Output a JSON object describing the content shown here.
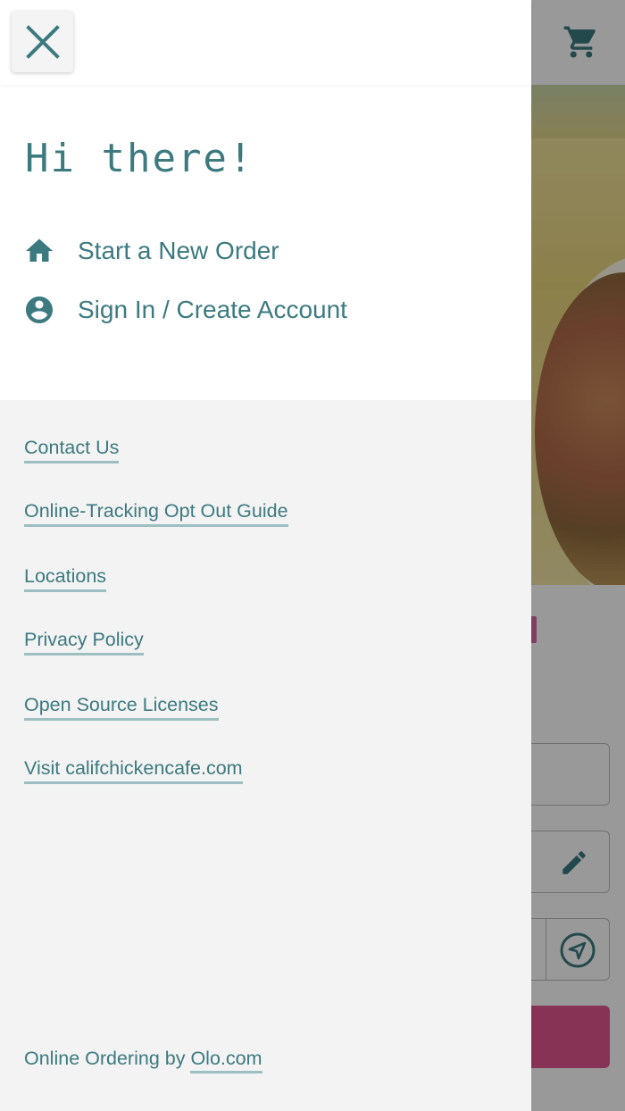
{
  "drawer": {
    "greeting": "Hi there!",
    "menu_items": [
      {
        "label": "Start a New Order",
        "icon": "home-icon"
      },
      {
        "label": "Sign In / Create Account",
        "icon": "account-circle-icon"
      }
    ],
    "links": [
      {
        "label": "Contact Us"
      },
      {
        "label": "Online-Tracking Opt Out Guide"
      },
      {
        "label": "Locations"
      },
      {
        "label": "Privacy Policy"
      },
      {
        "label": "Open Source Licenses"
      },
      {
        "label": "Visit califchickencafe.com"
      }
    ],
    "footer": {
      "prefix": "Online Ordering by ",
      "link": "Olo.com"
    }
  },
  "colors": {
    "accent_teal": "#3c7a80",
    "link_underline": "#9dbfc2",
    "drawer_bg": "#f3f3f3",
    "brand_pink": "#e0568f"
  },
  "icons": {
    "close": "close-icon",
    "cart": "cart-icon",
    "edit": "pencil-icon",
    "locate": "navigation-icon"
  }
}
